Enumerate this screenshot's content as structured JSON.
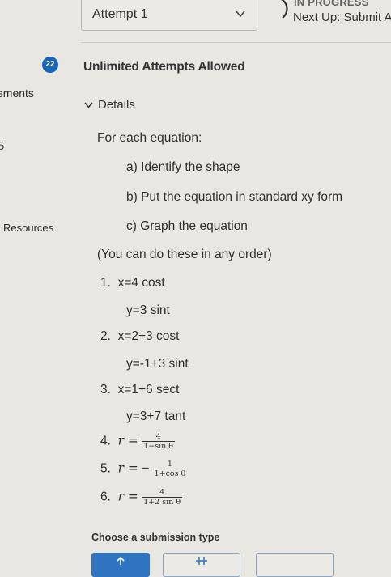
{
  "header": {
    "attempt_label": "Attempt 1",
    "status": "IN PROGRESS",
    "next_up": "Next Up: Submit A"
  },
  "question": {
    "number": "22",
    "attempts_note": "Unlimited Attempts Allowed",
    "details_label": "Details"
  },
  "sidebar": {
    "elements_label": "ements",
    "number_label": "5",
    "resources_label": "Resources"
  },
  "content": {
    "intro": "For each equation:",
    "steps": [
      "a) Identify the shape",
      "b) Put the equation in standard xy form",
      "c) Graph the equation"
    ],
    "order_note": "(You can do these in any order)",
    "items": [
      {
        "n": "1.",
        "x": "x=4 cost",
        "y": "y=3 sint"
      },
      {
        "n": "2.",
        "x": "x=2+3 cost",
        "y": "y=-1+3 sint"
      },
      {
        "n": "3.",
        "x": "x=1+6 sect",
        "y": "y=3+7 tant"
      }
    ],
    "polar": [
      {
        "n": "4.",
        "lhs": "r =",
        "sign": "",
        "num": "4",
        "den": "1−sin θ"
      },
      {
        "n": "5.",
        "lhs": "r =",
        "sign": "−",
        "num": "1",
        "den": "1+cos θ"
      },
      {
        "n": "6.",
        "lhs": "r =",
        "sign": "",
        "num": "4",
        "den": "1+2 sin θ"
      }
    ]
  },
  "submission": {
    "label": "Choose a submission type"
  },
  "colors": {
    "accent": "#1565c0",
    "background": "#e9e7e1"
  }
}
